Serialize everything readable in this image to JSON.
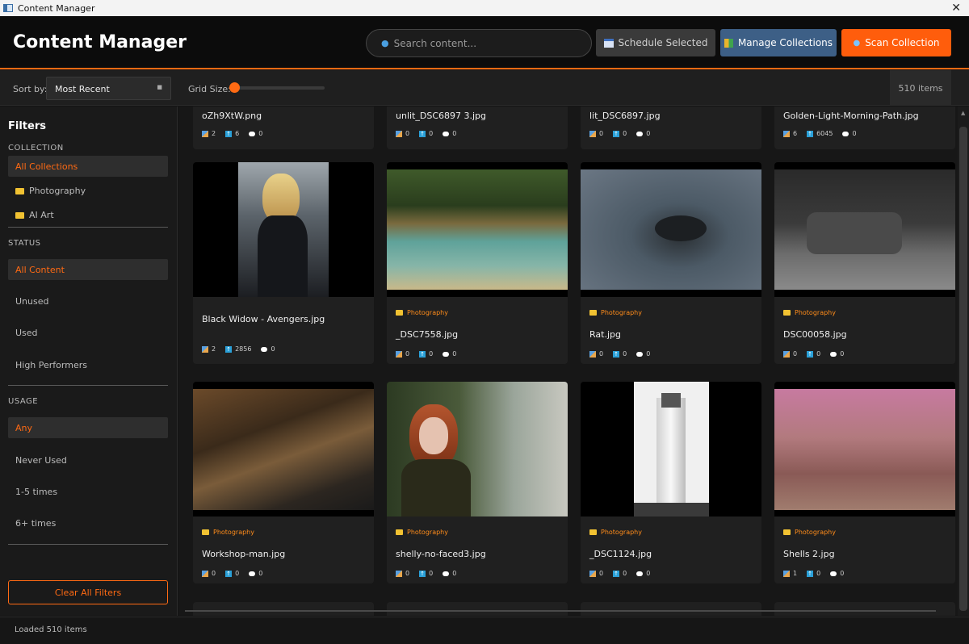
{
  "window": {
    "title": "Content Manager",
    "close": "✕"
  },
  "header": {
    "title": "Content Manager",
    "search_placeholder": "Search content...",
    "schedule_label": "Schedule Selected",
    "collections_label": "Manage Collections",
    "scan_label": "Scan Collection"
  },
  "toolbar": {
    "sort_label": "Sort by:",
    "sort_value": "Most Recent",
    "grid_label": "Grid Size:",
    "grid_level": 0,
    "item_count": "510 items"
  },
  "sidebar": {
    "title": "Filters",
    "collection_head": "COLLECTION",
    "collections": [
      "All Collections",
      "Photography",
      "AI Art"
    ],
    "status_head": "STATUS",
    "statuses": [
      "All Content",
      "Unused",
      "Used",
      "High Performers"
    ],
    "usage_head": "USAGE",
    "usages": [
      "Any",
      "Never Used",
      "1-5 times",
      "6+ times"
    ],
    "clear_label": "Clear All Filters"
  },
  "grid": {
    "row0": [
      {
        "name": "oZh9XtW.png",
        "a": "2",
        "b": "6",
        "c": "0"
      },
      {
        "name": "unlit_DSC6897 3.jpg",
        "a": "0",
        "b": "0",
        "c": "0"
      },
      {
        "name": "lit_DSC6897.jpg",
        "a": "0",
        "b": "0",
        "c": "0"
      },
      {
        "name": "Golden-Light-Morning-Path.jpg",
        "a": "6",
        "b": "6045",
        "c": "0"
      }
    ],
    "row1": [
      {
        "name": "Black Widow - Avengers.jpg",
        "collection": "",
        "a": "2",
        "b": "2856",
        "c": "0"
      },
      {
        "name": "_DSC7558.jpg",
        "collection": "Photography",
        "a": "0",
        "b": "0",
        "c": "0"
      },
      {
        "name": "Rat.jpg",
        "collection": "Photography",
        "a": "0",
        "b": "0",
        "c": "0"
      },
      {
        "name": "DSC00058.jpg",
        "collection": "Photography",
        "a": "0",
        "b": "0",
        "c": "0"
      }
    ],
    "row2": [
      {
        "name": "Workshop-man.jpg",
        "collection": "Photography",
        "a": "0",
        "b": "0",
        "c": "0"
      },
      {
        "name": "shelly-no-faced3.jpg",
        "collection": "Photography",
        "a": "0",
        "b": "0",
        "c": "0"
      },
      {
        "name": "_DSC1124.jpg",
        "collection": "Photography",
        "a": "0",
        "b": "0",
        "c": "0"
      },
      {
        "name": "Shells 2.jpg",
        "collection": "Photography",
        "a": "1",
        "b": "0",
        "c": "0"
      }
    ]
  },
  "status_bar": {
    "text": "Loaded 510 items"
  },
  "colors": {
    "accent": "#ff6a13",
    "collections_btn": "#3d5f86",
    "background": "#141414"
  }
}
